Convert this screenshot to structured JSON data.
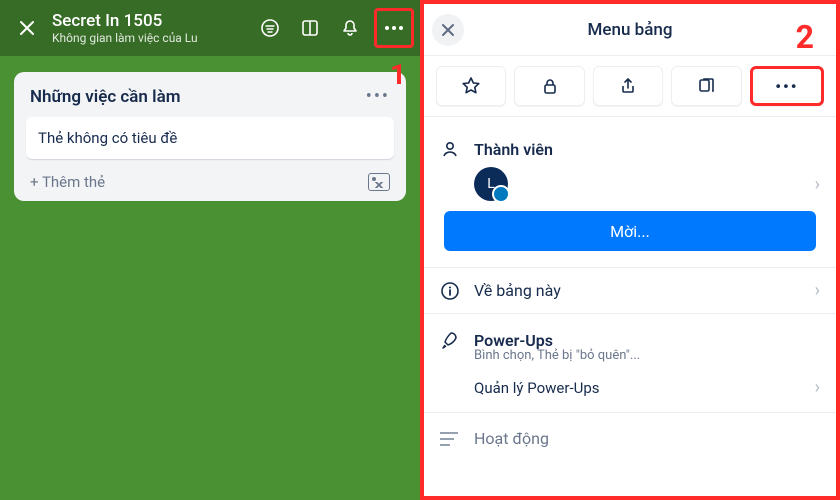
{
  "annotations": {
    "step1": "1",
    "step2": "2"
  },
  "board": {
    "title": "Secret In 1505",
    "workspace": "Không gian làm việc của Lu"
  },
  "list": {
    "title": "Những việc cần làm",
    "card1": "Thẻ không có tiêu đề",
    "add_card": "+ Thêm thẻ"
  },
  "menu": {
    "title": "Menu bảng",
    "more": "•••",
    "members_label": "Thành viên",
    "avatar_initial": "L",
    "invite": "Mời...",
    "about": "Về bảng này",
    "powerups": "Power-Ups",
    "powerups_sub": "Bình chọn, Thẻ bị \"bỏ quên\"...",
    "manage_powerups": "Quản lý Power-Ups",
    "activity": "Hoạt động"
  }
}
